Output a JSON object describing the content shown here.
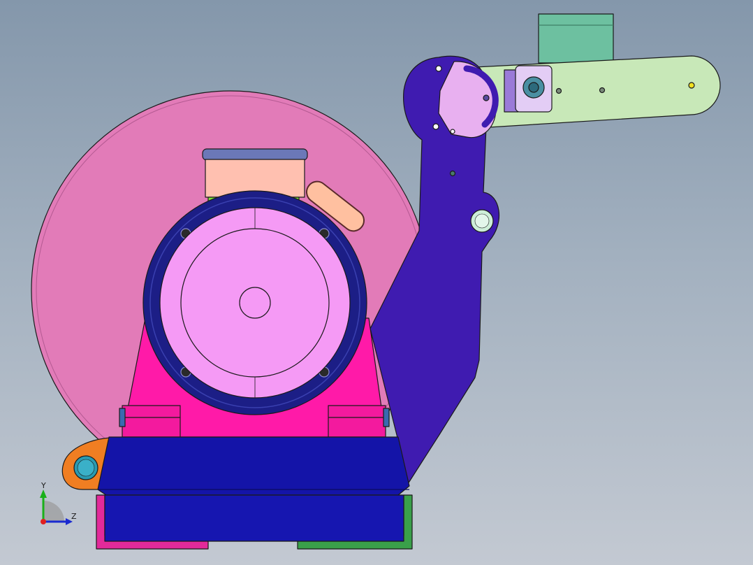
{
  "viewport": {
    "colors": {
      "background_top": "#8497ab",
      "background_bottom": "#c3c9d2",
      "disc": "#e27bb8",
      "motor_flange": "#1c1e86",
      "motor_cap": "#f59af5",
      "motor_housing": "#ff1aa8",
      "base_block": "#1414a8",
      "arm": "#3f1bb0",
      "lever": "#c8e8b8",
      "lever_bracket": "#6dc0a0",
      "cam_plate": "#e8b0f0",
      "terminal_box": "#ffc0b0",
      "green_window": "#7de23a",
      "orange_slot": "#ffc0a0",
      "pivot_lug": "#f07e22",
      "pivot_pin": "#2a9ab0"
    },
    "triad": {
      "y_label": "Y",
      "z_label": "Z"
    }
  }
}
